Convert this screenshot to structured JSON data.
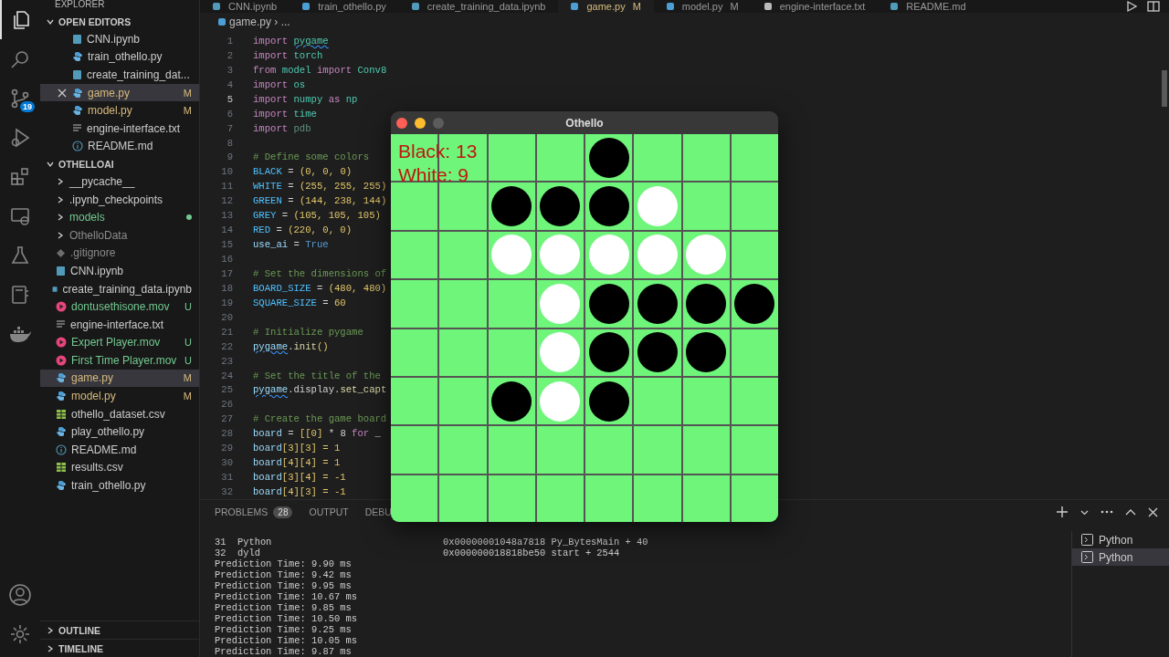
{
  "activity_bar": {
    "items": [
      {
        "kind": "files",
        "selected": true
      },
      {
        "kind": "search",
        "selected": false
      },
      {
        "kind": "git",
        "selected": false,
        "badge": "19"
      },
      {
        "kind": "debug",
        "selected": false
      },
      {
        "kind": "extensions",
        "selected": false
      },
      {
        "kind": "remote",
        "selected": false
      },
      {
        "kind": "flask",
        "selected": false
      },
      {
        "kind": "notebook",
        "selected": false
      },
      {
        "kind": "whale",
        "selected": false
      }
    ],
    "bottom": [
      {
        "kind": "account"
      },
      {
        "kind": "gear"
      }
    ]
  },
  "sidebar": {
    "title": "EXPLORER",
    "sections": [
      {
        "title": "OPEN EDITORS",
        "expanded": true,
        "items": [
          {
            "name": "CNN.ipynb",
            "kind": "notebook",
            "selected": false,
            "closable": false
          },
          {
            "name": "train_othello.py",
            "kind": "python",
            "selected": false,
            "closable": false
          },
          {
            "name": "create_training_dat...",
            "kind": "notebook",
            "selected": false,
            "closable": false
          },
          {
            "name": "game.py",
            "kind": "python",
            "status": "M",
            "color": "#d7ba7d",
            "selected": true,
            "closable": true
          },
          {
            "name": "model.py",
            "kind": "python",
            "status": "M",
            "color": "#d7ba7d",
            "selected": false,
            "closable": false
          },
          {
            "name": "engine-interface.txt",
            "kind": "text",
            "selected": false,
            "closable": false
          },
          {
            "name": "README.md",
            "kind": "info",
            "selected": false,
            "closable": false
          }
        ]
      },
      {
        "title": "OTHELLOAI",
        "expanded": true,
        "items": [
          {
            "name": "__pycache__",
            "kind": "folder",
            "selected": false
          },
          {
            "name": ".ipynb_checkpoints",
            "kind": "folder",
            "selected": false
          },
          {
            "name": "models",
            "kind": "folder",
            "color": "#73c991",
            "dot": true,
            "selected": false
          },
          {
            "name": "OthelloData",
            "kind": "folder",
            "color": "#8c8c8c",
            "selected": false
          },
          {
            "name": ".gitignore",
            "kind": "git",
            "color": "#8c8c8c",
            "selected": false
          },
          {
            "name": "CNN.ipynb",
            "kind": "notebook",
            "selected": false
          },
          {
            "name": "create_training_data.ipynb",
            "kind": "notebook",
            "selected": false
          },
          {
            "name": "dontusethisone.mov",
            "kind": "movie",
            "status": "U",
            "color": "#73c991",
            "selected": false
          },
          {
            "name": "engine-interface.txt",
            "kind": "text",
            "selected": false
          },
          {
            "name": "Expert Player.mov",
            "kind": "movie",
            "status": "U",
            "color": "#73c991",
            "selected": false
          },
          {
            "name": "First Time Player.mov",
            "kind": "movie",
            "status": "U",
            "color": "#73c991",
            "selected": false
          },
          {
            "name": "game.py",
            "kind": "python",
            "status": "M",
            "color": "#d7ba7d",
            "selected": true
          },
          {
            "name": "model.py",
            "kind": "python",
            "status": "M",
            "color": "#d7ba7d",
            "selected": false
          },
          {
            "name": "othello_dataset.csv",
            "kind": "csv",
            "selected": false
          },
          {
            "name": "play_othello.py",
            "kind": "python",
            "selected": false
          },
          {
            "name": "README.md",
            "kind": "info",
            "selected": false
          },
          {
            "name": "results.csv",
            "kind": "csv",
            "selected": false
          },
          {
            "name": "train_othello.py",
            "kind": "python",
            "selected": false
          }
        ]
      }
    ],
    "footer": [
      {
        "title": "OUTLINE",
        "expanded": false
      },
      {
        "title": "TIMELINE",
        "expanded": false
      }
    ]
  },
  "tabs": [
    {
      "label": "CNN.ipynb",
      "kind": "notebook",
      "selected": false
    },
    {
      "label": "train_othello.py",
      "kind": "python",
      "selected": false
    },
    {
      "label": "create_training_data.ipynb",
      "kind": "notebook",
      "selected": false
    },
    {
      "label": "game.py",
      "kind": "python",
      "status": "M",
      "selected": true
    },
    {
      "label": "model.py",
      "kind": "python",
      "status": "M",
      "selected": false
    },
    {
      "label": "engine-interface.txt",
      "kind": "text",
      "selected": false
    },
    {
      "label": "README.md",
      "kind": "info",
      "selected": false
    }
  ],
  "breadcrumb": {
    "file": "game.py",
    "separator": "›",
    "rest": "..."
  },
  "code": [
    {
      "n": "1",
      "current": false,
      "tokens": [
        {
          "t": "import ",
          "kind": "kw"
        },
        {
          "t": "pygame",
          "kind": "mod",
          "warn": true
        }
      ]
    },
    {
      "n": "2",
      "current": false,
      "tokens": [
        {
          "t": "import ",
          "kind": "kw"
        },
        {
          "t": "torch",
          "kind": "mod"
        }
      ]
    },
    {
      "n": "3",
      "current": false,
      "tokens": [
        {
          "t": "from ",
          "kind": "kw"
        },
        {
          "t": "model ",
          "kind": "mod"
        },
        {
          "t": "import ",
          "kind": "kw"
        },
        {
          "t": "Conv8",
          "kind": "mod"
        }
      ]
    },
    {
      "n": "4",
      "current": false,
      "tokens": [
        {
          "t": "import ",
          "kind": "kw"
        },
        {
          "t": "os",
          "kind": "mod"
        }
      ]
    },
    {
      "n": "5",
      "current": true,
      "tokens": [
        {
          "t": "import ",
          "kind": "kw"
        },
        {
          "t": "numpy ",
          "kind": "mod"
        },
        {
          "t": "as ",
          "kind": "kw"
        },
        {
          "t": "np",
          "kind": "mod"
        }
      ]
    },
    {
      "n": "6",
      "current": false,
      "tokens": [
        {
          "t": "import ",
          "kind": "kw"
        },
        {
          "t": "time",
          "kind": "mod"
        }
      ]
    },
    {
      "n": "7",
      "current": false,
      "tokens": [
        {
          "t": "import ",
          "kind": "kw"
        },
        {
          "t": "pdb",
          "kind": "dim"
        }
      ]
    },
    {
      "n": "8",
      "current": false
    },
    {
      "n": "9",
      "current": false,
      "tokens": [
        {
          "t": "# Define some colors",
          "kind": "comment"
        }
      ]
    },
    {
      "n": "10",
      "current": false,
      "tokens": [
        {
          "t": "BLACK",
          "kind": "const"
        },
        {
          "t": " = ",
          "kind": "plain"
        },
        {
          "t": "(0, 0, 0)",
          "kind": "num"
        }
      ]
    },
    {
      "n": "11",
      "current": false,
      "tokens": [
        {
          "t": "WHITE",
          "kind": "const"
        },
        {
          "t": " = ",
          "kind": "plain"
        },
        {
          "t": "(255, 255, 255)",
          "kind": "num"
        }
      ]
    },
    {
      "n": "12",
      "current": false,
      "tokens": [
        {
          "t": "GREEN",
          "kind": "const"
        },
        {
          "t": " = ",
          "kind": "plain"
        },
        {
          "t": "(144, 238, 144)",
          "kind": "num"
        }
      ]
    },
    {
      "n": "13",
      "current": false,
      "tokens": [
        {
          "t": "GREY",
          "kind": "const"
        },
        {
          "t": " = ",
          "kind": "plain"
        },
        {
          "t": "(105, 105, 105)",
          "kind": "num"
        }
      ]
    },
    {
      "n": "14",
      "current": false,
      "tokens": [
        {
          "t": "RED",
          "kind": "const"
        },
        {
          "t": " = ",
          "kind": "plain"
        },
        {
          "t": "(220, 0, 0)",
          "kind": "num"
        }
      ]
    },
    {
      "n": "15",
      "current": false,
      "tokens": [
        {
          "t": "use_ai",
          "kind": "var"
        },
        {
          "t": " = ",
          "kind": "plain"
        },
        {
          "t": "True",
          "kind": "builtin"
        }
      ]
    },
    {
      "n": "16",
      "current": false
    },
    {
      "n": "17",
      "current": false,
      "tokens": [
        {
          "t": "# Set the dimensions of",
          "kind": "comment"
        }
      ]
    },
    {
      "n": "18",
      "current": false,
      "tokens": [
        {
          "t": "BOARD_SIZE",
          "kind": "const"
        },
        {
          "t": " = ",
          "kind": "plain"
        },
        {
          "t": "(480, 480)",
          "kind": "num"
        }
      ]
    },
    {
      "n": "19",
      "current": false,
      "tokens": [
        {
          "t": "SQUARE_SIZE",
          "kind": "const"
        },
        {
          "t": " = ",
          "kind": "plain"
        },
        {
          "t": "60",
          "kind": "num"
        }
      ]
    },
    {
      "n": "20",
      "current": false
    },
    {
      "n": "21",
      "current": false,
      "tokens": [
        {
          "t": "# Initialize pygame",
          "kind": "comment"
        }
      ]
    },
    {
      "n": "22",
      "current": false,
      "tokens": [
        {
          "t": "pygame",
          "kind": "var",
          "warn": true
        },
        {
          "t": ".",
          "kind": "plain"
        },
        {
          "t": "init",
          "kind": "func"
        },
        {
          "t": "()",
          "kind": "num"
        }
      ]
    },
    {
      "n": "23",
      "current": false
    },
    {
      "n": "24",
      "current": false,
      "tokens": [
        {
          "t": "# Set the title of the",
          "kind": "comment"
        }
      ]
    },
    {
      "n": "25",
      "current": false,
      "tokens": [
        {
          "t": "pygame",
          "kind": "var",
          "warn": true
        },
        {
          "t": ".display.",
          "kind": "plain"
        },
        {
          "t": "set_capt",
          "kind": "func"
        }
      ]
    },
    {
      "n": "26",
      "current": false
    },
    {
      "n": "27",
      "current": false,
      "tokens": [
        {
          "t": "# Create the game board",
          "kind": "comment"
        }
      ]
    },
    {
      "n": "28",
      "current": false,
      "tokens": [
        {
          "t": "board",
          "kind": "var"
        },
        {
          "t": " = ",
          "kind": "plain"
        },
        {
          "t": "[[0]",
          "kind": "num"
        },
        {
          "t": " * 8 ",
          "kind": "plain"
        },
        {
          "t": "for",
          "kind": "kw"
        },
        {
          "t": " _",
          "kind": "plain"
        }
      ]
    },
    {
      "n": "29",
      "current": false,
      "tokens": [
        {
          "t": "board",
          "kind": "var"
        },
        {
          "t": "[3][3] = 1",
          "kind": "num"
        }
      ]
    },
    {
      "n": "30",
      "current": false,
      "tokens": [
        {
          "t": "board",
          "kind": "var"
        },
        {
          "t": "[4][4] = 1",
          "kind": "num"
        }
      ]
    },
    {
      "n": "31",
      "current": false,
      "tokens": [
        {
          "t": "board",
          "kind": "var"
        },
        {
          "t": "[3][4] = -1",
          "kind": "num"
        }
      ]
    },
    {
      "n": "32",
      "current": false,
      "tokens": [
        {
          "t": "board",
          "kind": "var"
        },
        {
          "t": "[4][3] = -1",
          "kind": "num"
        }
      ]
    }
  ],
  "panel": {
    "tabs": [
      {
        "label": "PROBLEMS",
        "badge": "28",
        "selected": false
      },
      {
        "label": "OUTPUT",
        "selected": false
      },
      {
        "label": "DEBU",
        "selected": false
      }
    ],
    "terminal": [
      {
        "left": "31  Python",
        "right": "0x00000001048a7818 Py_BytesMain + 40"
      },
      {
        "left": "32  dyld",
        "right": "0x000000018818be50 start + 2544"
      },
      {
        "left": "Prediction Time: 9.90 ms"
      },
      {
        "left": "Prediction Time: 9.42 ms"
      },
      {
        "left": "Prediction Time: 9.95 ms"
      },
      {
        "left": "Prediction Time: 10.67 ms"
      },
      {
        "left": "Prediction Time: 9.85 ms"
      },
      {
        "left": "Prediction Time: 10.50 ms"
      },
      {
        "left": "Prediction Time: 9.25 ms"
      },
      {
        "left": "Prediction Time: 10.05 ms"
      },
      {
        "left": "Prediction Time: 9.87 ms"
      }
    ],
    "sessions": [
      {
        "label": "Python",
        "selected": false
      },
      {
        "label": "Python",
        "selected": true
      }
    ]
  },
  "othello": {
    "title": "Othello",
    "score": [
      "Black: 13",
      "White: 9"
    ],
    "cells": [
      {
        "kind": "empty"
      },
      {
        "kind": "empty"
      },
      {
        "kind": "empty"
      },
      {
        "kind": "empty"
      },
      {
        "kind": "black"
      },
      {
        "kind": "empty"
      },
      {
        "kind": "empty"
      },
      {
        "kind": "empty"
      },
      {
        "kind": "empty"
      },
      {
        "kind": "empty"
      },
      {
        "kind": "black"
      },
      {
        "kind": "black"
      },
      {
        "kind": "black"
      },
      {
        "kind": "white"
      },
      {
        "kind": "empty"
      },
      {
        "kind": "empty"
      },
      {
        "kind": "empty"
      },
      {
        "kind": "empty"
      },
      {
        "kind": "white"
      },
      {
        "kind": "white"
      },
      {
        "kind": "white"
      },
      {
        "kind": "white"
      },
      {
        "kind": "white"
      },
      {
        "kind": "empty"
      },
      {
        "kind": "empty"
      },
      {
        "kind": "empty"
      },
      {
        "kind": "empty"
      },
      {
        "kind": "white"
      },
      {
        "kind": "black"
      },
      {
        "kind": "black"
      },
      {
        "kind": "black"
      },
      {
        "kind": "black"
      },
      {
        "kind": "empty"
      },
      {
        "kind": "empty"
      },
      {
        "kind": "empty"
      },
      {
        "kind": "white"
      },
      {
        "kind": "black"
      },
      {
        "kind": "black"
      },
      {
        "kind": "black"
      },
      {
        "kind": "empty"
      },
      {
        "kind": "empty"
      },
      {
        "kind": "empty"
      },
      {
        "kind": "black"
      },
      {
        "kind": "white"
      },
      {
        "kind": "black"
      },
      {
        "kind": "empty"
      },
      {
        "kind": "empty"
      },
      {
        "kind": "empty"
      },
      {
        "kind": "empty"
      },
      {
        "kind": "empty"
      },
      {
        "kind": "empty"
      },
      {
        "kind": "empty"
      },
      {
        "kind": "empty"
      },
      {
        "kind": "empty"
      },
      {
        "kind": "empty"
      },
      {
        "kind": "empty"
      },
      {
        "kind": "empty"
      },
      {
        "kind": "empty"
      },
      {
        "kind": "empty"
      },
      {
        "kind": "empty"
      },
      {
        "kind": "empty"
      },
      {
        "kind": "empty"
      },
      {
        "kind": "empty"
      },
      {
        "kind": "empty"
      }
    ]
  }
}
